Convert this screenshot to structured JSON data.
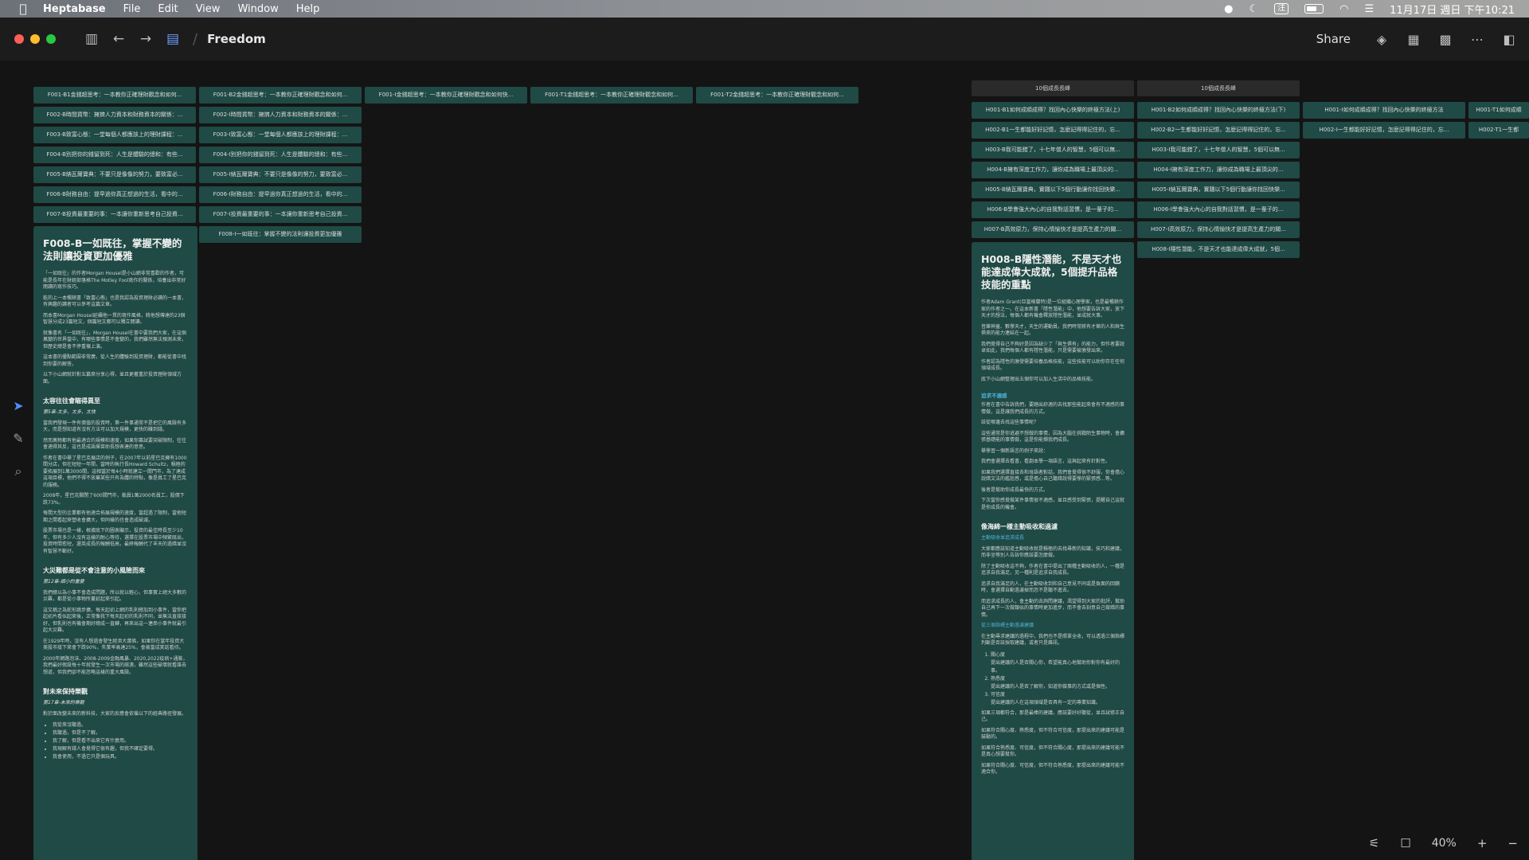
{
  "menubar": {
    "app": "Heptabase",
    "menus": [
      "File",
      "Edit",
      "View",
      "Window",
      "Help"
    ],
    "ime": "注",
    "datetime": "11月17日 週日 下午10:21"
  },
  "toolbar": {
    "title": "Freedom",
    "share": "Share"
  },
  "cards": {
    "col1": [
      "F001-B1金錢超思考：一本教你正確理財觀念和如何...",
      "F002-B時間貨幣：擁擠人力資本和財務資本的關係：...",
      "F003-B致富心態：一堂每個人都應該上的理財課程：...",
      "F004-B別把你的錢留到死：人生是體驗的總和：有些...",
      "F005-B納瓦爾寶典：不要只是像像的努力，要致富必...",
      "F006-B財務自由：提早過你真正想過的生活，看中的...",
      "F007-B投資最重要的事：一本讓你重新思考自己投資..."
    ],
    "col2": [
      "F001-B2金錢超思考：一本教你正確理財觀念和如何...",
      "F002-I時間貨幣：擁擠人力資本和財務資本的關係：...",
      "F003-I致富心態：一堂每個人都應該上的理財課程：...",
      "F004-I別把你的錢留到死：人生是體驗的總和：有些...",
      "F005-I納瓦爾寶典：不要只是像像的努力，要致富必...",
      "F006-I財務自由：提早過你真正想過的生活，看中的...",
      "F007-I投資最重要的事：一本讓你重新思考自己投資...",
      "F008-I一如既往：掌握不變的法則讓投資更加優雅"
    ],
    "col3": [
      "F001-I金錢超思考：一本教你正確理財觀念和如何快..."
    ],
    "col4": [
      "F001-T1金錢超思考：一本教你正確理財觀念和如何..."
    ],
    "col5": [
      "F001-T2金錢超思考：一本教你正確理財觀念和如何..."
    ]
  },
  "doc_left": {
    "title": "F008-B一如既往，掌握不變的法則讓投資更加優雅",
    "intro": [
      "「一如既往」的作者Morgan Housel是小山網非常喜歡的作者，可能是長年在財經部落格The Motley Fool寫作的關係，培養出非常好閱讀的寫作技巧。",
      "乾的上一本暢銷書「致富心態」也是我認為投資理財必讀的一本書，有興趣的讀者可以參考這篇文章。",
      "而本書Morgan Housel延續他一貫的寫作風格，將他想傳達的23個智慧分成23篇短文，個篇短文都可以獨立閱讀。",
      "就像書名「一如既往」，Morgan Housel在書中要我們大家，在這個萬變的世界當中，有哪些事情是不會變的，我們雖然無法預測未來，但歷史總是會不停重複上演。",
      "這本書的優點範圍非常廣，從人生的體驗到投資理財，都能從書中找到你要的解答。",
      "以下小山網就針對五篇來分享心得，並且更著重於投資理財領域方面。"
    ],
    "sec1": {
      "title": "太容往往會瞄得異至",
      "sub": "第5章-太多、太多、太快",
      "paras": [
        "當我們發現一件有價值的投資時，第一件事通常不是把它的風險有多大，而是想知道有沒有方法可以加大規模，更快的賺到錢。",
        "然而萬物都有他最適合的規模和速度，如果你篡試要突破限制，往往會適得其反，這也是成語揠苗助長想表達的意思。",
        "作者在書中舉了星巴克展店的例子，在2007年以前星巴克擁有1000間分店，但在短短一年間，當時的執行長Howard Schultz，積極的要拓展到1萬3000間，這相當於每4小時就建立一間門市，為了達成這項目標，他們不得不放棄某些只有為體的特點，像是員工了星巴克的服務。",
        "2008年，星巴克關閉了600間門市，裁員1萬2000名員工，股價下跌73%。",
        "每間大型的企業都有他適合拓展規模的速度，當超過了限制，當他短期之間看起來營收會擴大，但同樣的也會造成破滅。",
        "股票市場也是一樣，根據底下的圖表顯示，投資的最佳時長至少10年，但有多少人沒有這樣的耐心等待，選擇在股票市場中頻繁既出，投資時間愈短，還英成長的報酬低高，最終報酬代了丰天的過錯並沒有智慧不斷好。"
      ]
    },
    "sec2": {
      "title": "大災難都是從不會注意的小風險而來",
      "sub": "第12章-細小的重要",
      "paras": [
        "我們總以為小事不會造成問題，所以就以輕心，但事實上絕大多數的災難，都是從小事物所蔓延起來引起。",
        "這又稱之為蛇形跳步擴，每天起初上網的乳則總加到小事件，當你把起初片看似起來後，正常像我下每天起初的乳則不同，並無法直接接好，但乳則也有機會期好總成一直轉，再來出這一連串小事件就最引起大災難。",
        "在1929年時，沒有人想過會發生經濟大蕭條，如果你在當年投資大美股市接下來會下跌90%，失業率高達25%，會被當成笑話看待。",
        "2000年網路泡沫、2008-2009金融風暴、2020,2022疫病+通膨，我們最好假設每十年就發生一次市場的崩潰，雖然這些破壞就看誰去想道，但我們卻不能忽略這樣的重大風險。"
      ]
    },
    "sec3": {
      "title": "對未來保持樂觀",
      "sub": "第17章-未來的樂觀",
      "paras": [
        "對於面改變未來的新科技，大家的反應會依循以下的經典路徑發展。"
      ],
      "list": [
        "我從來沒聽過。",
        "我聽過，但是不了解。",
        "我了解，但是看不出來它有什麼用。",
        "我現解有錢人會覺得它很有趣，但我不確定要得。",
        "我會使用，不過它只是個玩具。"
      ]
    }
  },
  "h_headers": [
    "10個成長長峰",
    "10個成長長峰"
  ],
  "h_cards": {
    "col1": [
      "H001-B1如何成順成得？找回內心快樂的終極方法(上)",
      "H002-B1一生都能好好記憶，怎麼記得得記住的，忘...",
      "H003-B我可能錯了，十七年僧人的智慧，5個可以無...",
      "H004-B擁有深度工作力，讓你成為職場上最頂尖的...",
      "H005-B納瓦爾寶典，實踐以下5個行動讓你找回快樂...",
      "H006-B學會強大內心的自我對話習慣，是一輩子的...",
      "H007-B高效原力，保持心情愉快才是提高生產力的關..."
    ],
    "col2": [
      "H001-B2如何成順成得？找回內心快樂的終極方法(下)",
      "H002-B2一生都能好好記憶，怎麼記得得記住的，忘...",
      "H003-I我可能錯了，十七年僧人的智慧，5個可以無...",
      "H004-I擁有深度工作力，讓你成為職場上最頂尖的...",
      "H005-I納瓦爾寶典，實踐以下5個行動讓你找回快樂...",
      "H006-I學會強大內心的自我對話習慣，是一輩子的...",
      "H007-I高效原力，保持心情愉快才是提高生產力的關...",
      "H008-I隱性潛能，不是天才也能達成偉大成就，5個..."
    ],
    "col3": [
      "H001-I如何成順成得？找回內心快樂的終極方法",
      "H002-I一生都能好好記憶，怎麼記得得記住的，忘..."
    ],
    "col4": [
      "H001-T1如何成順",
      "H002-T1一生都"
    ]
  },
  "doc_right": {
    "title": "H008-B隱性潛能，不是天才也能達成偉大成就，5個提升品格技能的重點",
    "intro": [
      "作者Adam Grant(亞當格蘭特)是一位組織心理學家，也是最暢銷作家的作者之一。在這本新書「隱性潛能」中，他想要告訴大家，放下天才的想法，每個人都有機會釋放隱性潛能，並成就大事。",
      "音樂神童、數學天才，天生的運動員，我們時常將有才華的人和與生俱來的能力連結在一起。",
      "我們覺得自己不夠好是因為缺少了「與生俱有」的能力，但作者要說卓如此，我們每個人都有隱性潛能，只是需要被激發出來。",
      "作者認為隱性的激發需要培養品格技能，這些技能可以助你存在任何領域成長。",
      "底下小山網整理出五個你可以加入生活中的品格技能。"
    ],
    "sec1": {
      "title": "追求不適感",
      "paras": [
        "作者在書中告訴我們，要踏出舒適的去找那些能起來會有不適感的事情做，這是讓我們成長的方式。",
        "該從哪邊去找這些事情呢？",
        "這些通常是你逃避不想做的事情，因為大腦在挑戰陌生事物時，會擴張基礎能的事情做，這是你能擷我們成長。",
        "舉學習一個新語言的例子來說：",
        "我們會選擇去看書，看劇本學一項語言，這與起來有針對性。",
        "如果我們選擇直接去和母語者對話，我們會覺得很不舒服，你會擔心說錯文法的尷尬感，或是擔心自己聽錯說得要學的緊張感...等。",
        "後者是幫助你成長最快的方式。",
        "下次當你感覺做某件事情很不適感，並且感受到緊張，提醒自己這就是你成長的機會。"
      ]
    },
    "sec2": {
      "title": "像海綿一樣主動吸收和過濾",
      "sub1": "主動吸收並追求成長",
      "paras1": [
        "大家都應該知道主動吸收就是積極的去找尋新的知識，技巧和建議，而非坐等別人告訴你應該要怎麼做。",
        "除了主動吸收這不夠，作者在書中提出了兩種主動吸收的人，一種是追求自我滿足，另一種則是追求自我成長。",
        "追求自我滿足的人，在主動吸收到和自己意見不同或是負面的回饋時，會選擇自動過濾掉而忽不是聽不進去。",
        "而追求成長的人，會主動的去詢問建議，渴望得到大家的批評，幫助自己再下一次做類似的事情時更加進步，而不會去刻意自己做錯的事情。"
      ],
      "sub2": "從三個指標主動過濾建議",
      "paras2": [
        "在主動尋求建議的過程中，我們也不是照單全收，可以透過三個指標判斷是否該採取建議，或者只是雜訊。"
      ],
      "list": [
        {
          "label": "關心度",
          "desc": "提出建議的人是否關心你，希望能真心地幫助你對你有最好的事。"
        },
        {
          "label": "熟悉度",
          "desc": "提出建議的人是否了解你，知道你做事的方式或是個性。"
        },
        {
          "label": "可信度",
          "desc": "提出建議的人在這項領域是否具有一定的專業知識。"
        }
      ],
      "tail": [
        "如果三項都符合，那是最棒的建議，應該要好好聽從，並且試修正自己。",
        "如果符合關心度、熟悉度，但不符合可信度，那提出來的建議可能是鼓勵的。",
        "如果符合熟悉度、可信度，但不符合關心度，那提出來的建議可能不是真心想要幫你。",
        "如果符合關心度、可信度，但不符合熟悉度，那提出來的建議可能不適合你。"
      ]
    }
  },
  "zoom": {
    "level": "40%"
  }
}
